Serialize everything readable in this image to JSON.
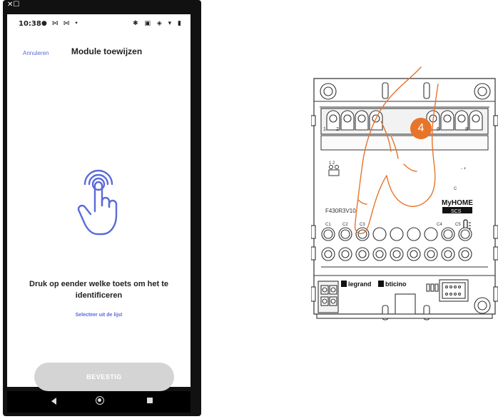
{
  "status_bar": {
    "time": "10:38",
    "left_icons": "● ⋈ ⋈ •",
    "right_icons": "✱ ▣ ◈ ▾ ▮"
  },
  "header": {
    "cancel_label": "Annuleren",
    "title": "Module toewijzen"
  },
  "main": {
    "instruction": "Druk op eender welke toets om het te identificeren",
    "select_list_label": "Selecteer uit de lijst",
    "confirm_label": "BEVESTIG"
  },
  "icons": {
    "top_corner": "close-edit-icon",
    "touch": "finger-touch-icon"
  },
  "device": {
    "model": "F430R3V10",
    "brand_myhome": "MyHOME",
    "brand_scs": "SCS",
    "brand_legrand": "legrand",
    "brand_bticino": "bticino",
    "top_terminal_labels": [
      "1",
      "2",
      "5",
      "6",
      "8"
    ],
    "mid_labels": [
      "1 2",
      "- +",
      "C"
    ],
    "button_labels": [
      "C1",
      "C2",
      "C3",
      "C4",
      "C5"
    ],
    "step_number": "4"
  },
  "colors": {
    "accent": "#5a6bd8",
    "step_badge": "#e8742a",
    "finger_outline": "#e8742a",
    "disabled_button": "#d4d4d4"
  }
}
